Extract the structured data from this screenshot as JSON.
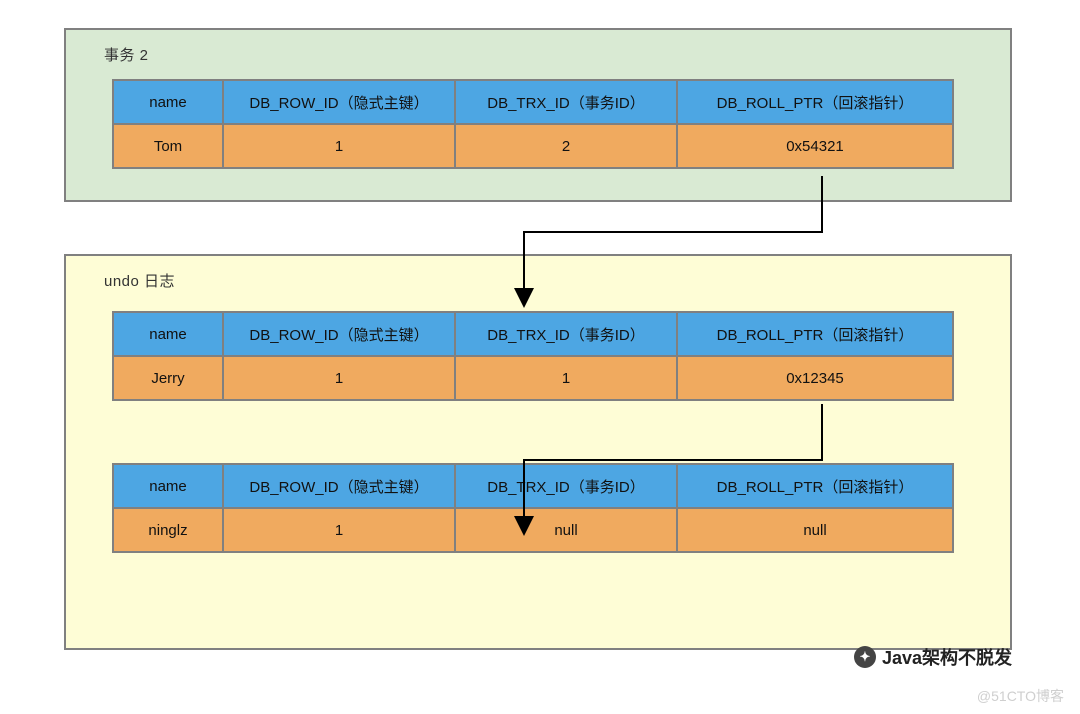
{
  "panels": {
    "transaction": {
      "title": "事务 2"
    },
    "undo": {
      "title": "undo 日志"
    }
  },
  "headers": {
    "name": "name",
    "rowid": "DB_ROW_ID（隐式主键）",
    "trxid": "DB_TRX_ID（事务ID）",
    "rollptr": "DB_ROLL_PTR（回滚指针）"
  },
  "rows": {
    "r1": {
      "name": "Tom",
      "rowid": "1",
      "trxid": "2",
      "rollptr": "0x54321"
    },
    "r2": {
      "name": "Jerry",
      "rowid": "1",
      "trxid": "1",
      "rollptr": "0x12345"
    },
    "r3": {
      "name": "ninglz",
      "rowid": "1",
      "trxid": "null",
      "rollptr": "null"
    }
  },
  "watermark": {
    "channel": "Java架构不脱发",
    "blog": "@51CTO博客"
  }
}
